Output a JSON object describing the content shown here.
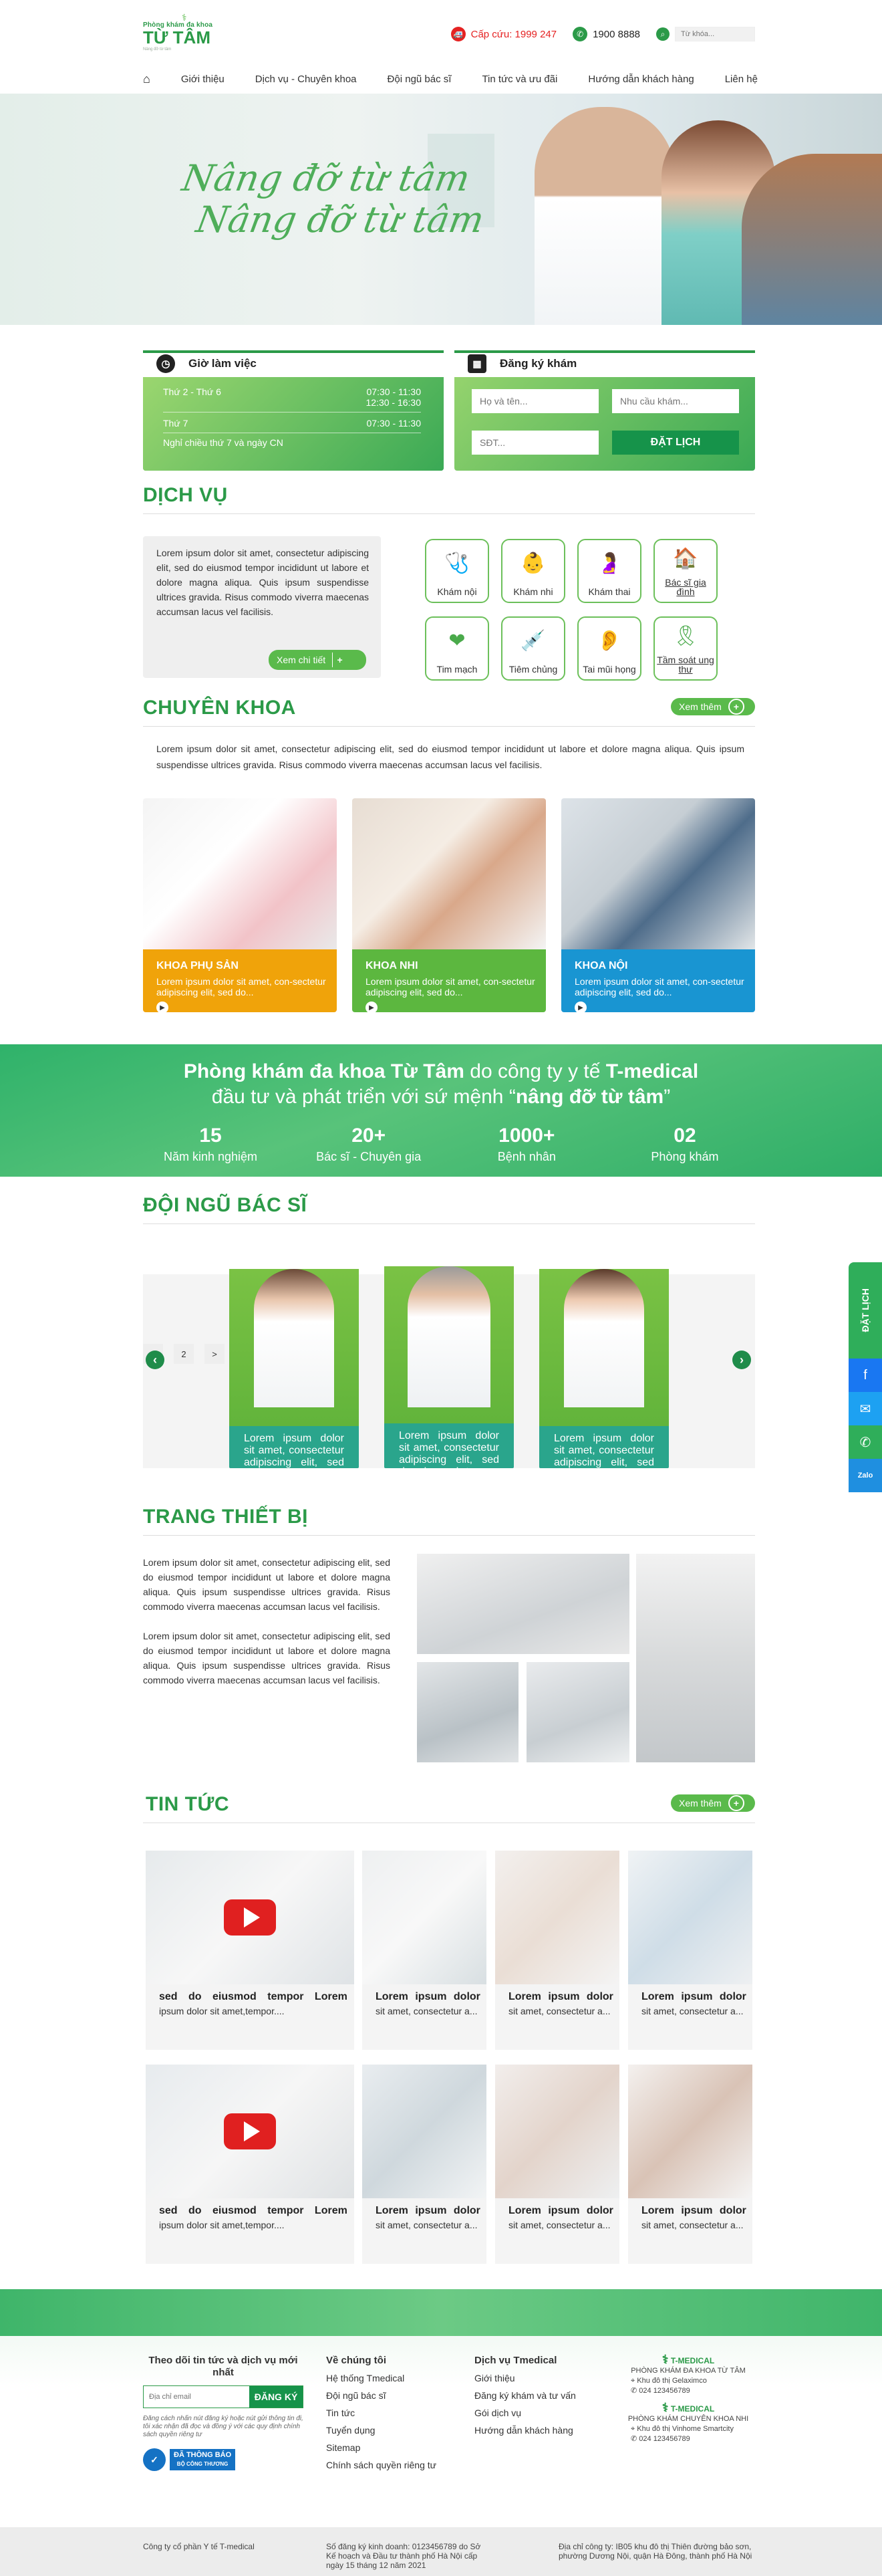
{
  "header": {
    "logo_top": "Phòng khám đa khoa",
    "logo_name": "TỪ TÂM",
    "logo_sub": "Nâng đỡ từ tâm",
    "emergency": "Cấp cứu: 1999 247",
    "hotline": "1900 8888",
    "search_placeholder": "Từ khóa..."
  },
  "nav": [
    "Giới thiệu",
    "Dịch vụ - Chuyên khoa",
    "Đội ngũ bác sĩ",
    "Tin tức và ưu đãi",
    "Hướng dẫn khách hàng",
    "Liên hệ"
  ],
  "hero": {
    "line1": "Nâng đỡ từ tâm",
    "line2": "Nâng đỡ từ tâm"
  },
  "hours": {
    "title": "Giờ làm việc",
    "row1_day": "Thứ 2 - Thứ 6",
    "row1_time1": "07:30 - 11:30",
    "row1_time2": "12:30 - 16:30",
    "row2_day": "Thứ 7",
    "row2_time": "07:30 - 11:30",
    "note": "Nghỉ chiều thứ 7 và ngày CN"
  },
  "booking": {
    "title": "Đăng ký khám",
    "name_ph": "Họ và tên...",
    "need_ph": "Nhu cầu khám...",
    "phone_ph": "SĐT...",
    "submit": "ĐẶT LỊCH"
  },
  "services": {
    "title": "DỊCH VỤ",
    "text": "Lorem ipsum dolor sit amet, consectetur adipiscing elit, sed do eiusmod tempor incididunt ut labore et dolore magna aliqua. Quis ipsum suspendisse ultrices gravida. Risus commodo viverra maecenas accumsan lacus vel facilisis.",
    "detail": "Xem chi tiết",
    "items": [
      {
        "label": "Khám nội",
        "icon": "🩺"
      },
      {
        "label": "Khám nhi",
        "icon": "👶"
      },
      {
        "label": "Khám thai",
        "icon": "🤰"
      },
      {
        "label": "Bác sĩ gia đình",
        "icon": "🏠"
      },
      {
        "label": "Tim mạch",
        "icon": "❤"
      },
      {
        "label": "Tiêm chủng",
        "icon": "💉"
      },
      {
        "label": "Tai mũi họng",
        "icon": "👂"
      },
      {
        "label": "Tầm soát ung thư",
        "icon": "🎗"
      }
    ]
  },
  "specialty": {
    "title": "CHUYÊN KHOA",
    "more": "Xem thêm",
    "text": "Lorem ipsum dolor sit amet, consectetur adipiscing elit, sed do eiusmod tempor incididunt ut labore et dolore magna aliqua. Quis ipsum suspendisse ultrices gravida. Risus commodo viverra maecenas accumsan lacus vel facilisis.",
    "cards": [
      {
        "name": "KHOA PHỤ SẢN",
        "desc": "Lorem ipsum dolor sit amet, con-sectetur adipiscing elit, sed do...",
        "color": "#f0a30a"
      },
      {
        "name": "KHOA NHI",
        "desc": "Lorem ipsum dolor sit amet, con-sectetur adipiscing elit, sed do...",
        "color": "#5cb73f"
      },
      {
        "name": "KHOA NỘI",
        "desc": "Lorem ipsum dolor sit amet, con-sectetur adipiscing elit, sed do...",
        "color": "#1995d2"
      }
    ]
  },
  "banner": {
    "line1_a": "Phòng khám đa khoa Từ Tâm",
    "line1_b": " do công ty y tế ",
    "line1_c": "T-medical",
    "line2_a": "đầu tư và phát triển với sứ mệnh “",
    "line2_b": "nâng đỡ từ tâm",
    "line2_c": "”",
    "stats": [
      {
        "n": "15",
        "l": "Năm kinh nghiệm"
      },
      {
        "n": "20+",
        "l": "Bác sĩ - Chuyên gia"
      },
      {
        "n": "1000+",
        "l": "Bệnh nhân"
      },
      {
        "n": "02",
        "l": "Phòng khám"
      }
    ]
  },
  "doctors": {
    "title": "ĐỘI NGŨ BÁC SĨ",
    "desc": "Lorem ipsum dolor sit amet, consectetur adipiscing elit, sed do eiusmod tempor inci-",
    "pages": [
      "1",
      "2",
      ">"
    ]
  },
  "equipment": {
    "title": "TRANG THIẾT BỊ",
    "p1": "Lorem ipsum dolor sit amet, consectetur adipiscing elit, sed do eiusmod tempor incididunt ut labore et dolore magna aliqua. Quis ipsum suspendisse ultrices gravida. Risus commodo viverra maecenas accumsan lacus vel facilisis.",
    "p2": "Lorem ipsum dolor sit amet, consectetur adipiscing elit, sed do eiusmod tempor incididunt ut labore et dolore magna aliqua. Quis ipsum suspendisse ultrices gravida. Risus commodo viverra maecenas accumsan lacus vel facilisis."
  },
  "news": {
    "title": "TIN  TỨC",
    "more": "Xem thêm",
    "video_title": "sed do eiusmod tempor Lorem",
    "video_desc": "ipsum dolor sit amet,tempor....",
    "item_title": "Lorem ipsum dolor",
    "item_desc": "sit amet, consectetur a..."
  },
  "sidebar": {
    "book": "ĐẶT LỊCH",
    "zalo": "Zalo"
  },
  "footer": {
    "sub_title": "Theo dõi tin tức và dịch vụ mới nhất",
    "email_ph": "Địa chỉ email",
    "register": "ĐĂNG KÝ",
    "note": "Đăng cách nhấn nút đăng ký hoặc nút gửi thông tin đi, tôi xác nhận đã đọc và đồng ý với các quy định chính sách quyền riêng tư",
    "badge_1": "ĐÃ THÔNG BÁO",
    "badge_2": "BỘ CÔNG THƯƠNG",
    "about_title": "Về chúng tôi",
    "about": [
      "Hệ thống Tmedical",
      "Đội ngũ bác sĩ",
      "Tin tức",
      "Tuyển dụng",
      "Sitemap",
      "Chính sách quyền riêng tư"
    ],
    "svc_title": "Dịch vụ Tmedical",
    "svc": [
      "Giới thiệu",
      "Đăng ký khám và tư vấn",
      "Gói dịch vụ",
      "Hướng dẫn khách hàng"
    ],
    "brand": "T-MEDICAL",
    "clinic1": "PHÒNG KHÁM ĐA KHOA TỪ TÂM",
    "addr1": "Khu đô thị Gelaximco",
    "phone1": "024 123456789",
    "clinic2": "PHÒNG KHÁM CHUYÊN KHOA NHI",
    "addr2": "Khu đô thị Vinhome Smartcity",
    "phone2": "024 123456789",
    "company": "Công ty cổ phần Y tế T-medical",
    "license": "Số đăng ký kinh doanh: 0123456789 do Sở Kế hoạch và Đầu tư thành phố Hà Nội cấp ngày 15 tháng 12 năm 2021",
    "address": "Địa chỉ công ty: IB05 khu đô thị Thiên đường bảo sơn, phường Dương Nội, quận Hà Đông, thành phố Hà Nội"
  },
  "colors": {
    "primary": "#2b9a48",
    "accent": "#5aba4b"
  }
}
